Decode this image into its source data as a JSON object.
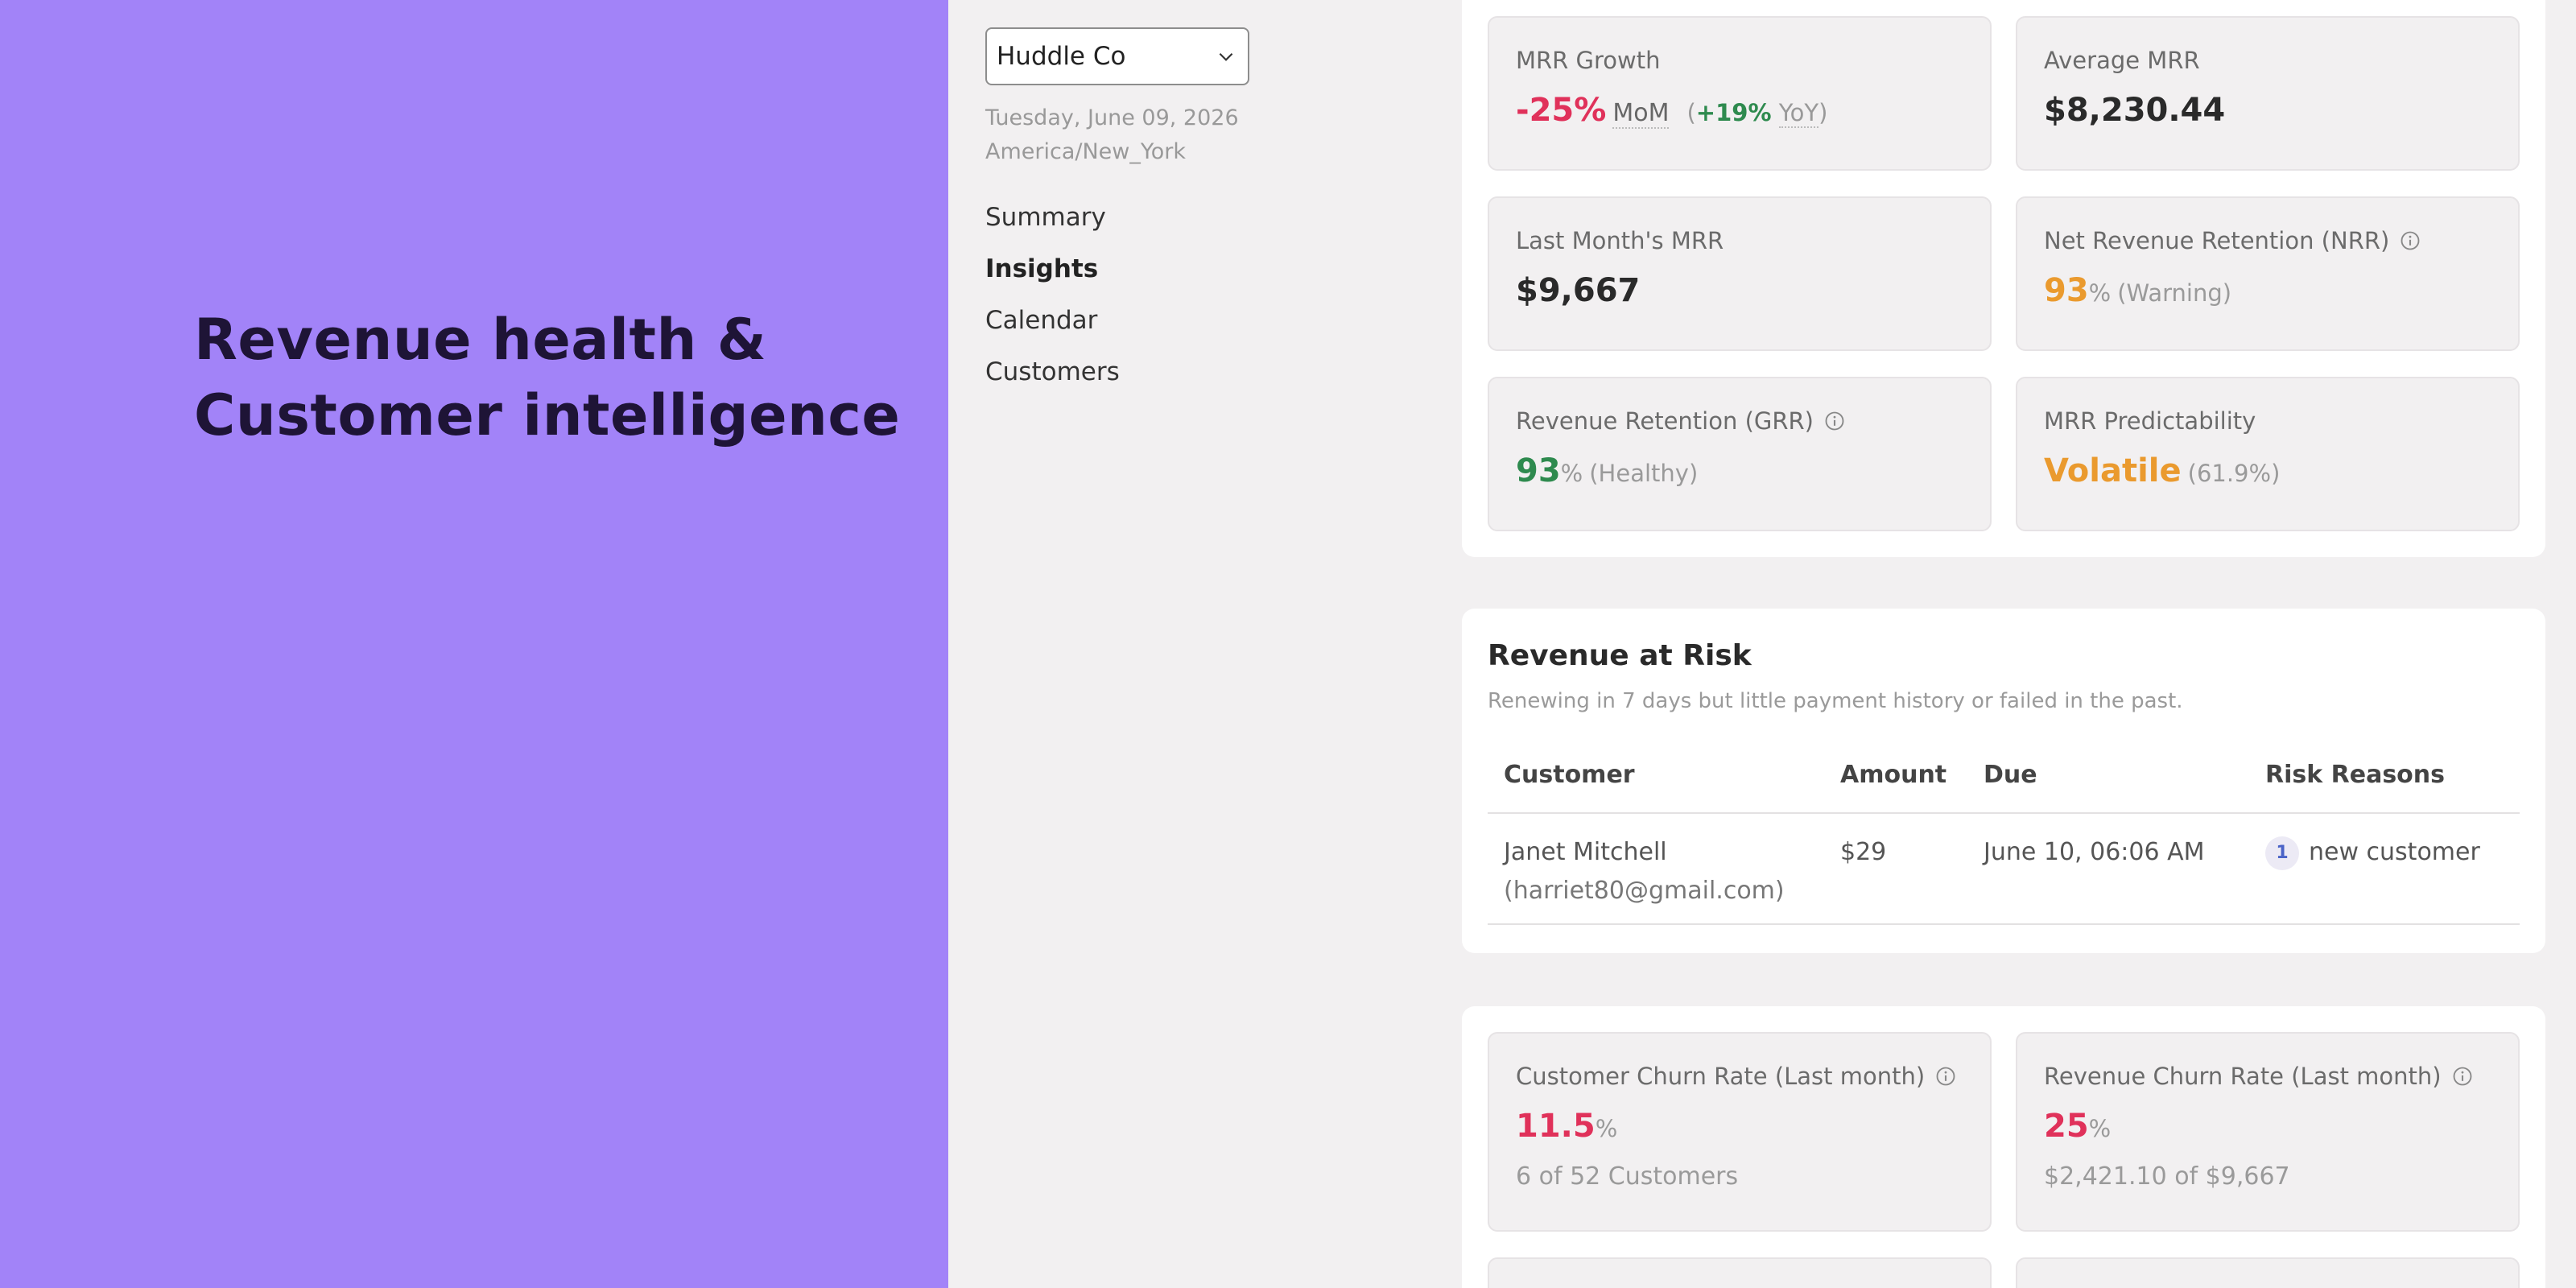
{
  "hero": {
    "title_line1": "Revenue health &",
    "title_line2": "Customer intelligence"
  },
  "sidebar": {
    "workspace": "Huddle Co",
    "date": "Tuesday, June 09, 2026",
    "timezone": "America/New_York",
    "nav": [
      {
        "label": "Summary",
        "active": false
      },
      {
        "label": "Insights",
        "active": true
      },
      {
        "label": "Calendar",
        "active": false
      },
      {
        "label": "Customers",
        "active": false
      }
    ]
  },
  "metrics": {
    "mrr_growth": {
      "label": "MRR Growth",
      "value": "-25%",
      "period": "MoM",
      "yoy_open": "(",
      "yoy_value": "+19%",
      "yoy_label": "YoY",
      "yoy_close": ")"
    },
    "average_mrr": {
      "label": "Average MRR",
      "value": "$8,230.44"
    },
    "last_month_mrr": {
      "label": "Last Month's MRR",
      "value": "$9,667"
    },
    "nrr": {
      "label": "Net Revenue Retention (NRR)",
      "value": "93",
      "unit": "%",
      "status": "(Warning)"
    },
    "grr": {
      "label": "Revenue Retention (GRR)",
      "value": "93",
      "unit": "%",
      "status": "(Healthy)"
    },
    "predictability": {
      "label": "MRR Predictability",
      "value": "Volatile",
      "detail": "(61.9%)"
    }
  },
  "risk": {
    "title": "Revenue at Risk",
    "description": "Renewing in 7 days but little payment history or failed in the past.",
    "columns": [
      "Customer",
      "Amount",
      "Due",
      "Risk Reasons"
    ],
    "rows": [
      {
        "name": "Janet Mitchell",
        "email": "(harriet80@gmail.com)",
        "amount": "$29",
        "due": "June 10, 06:06 AM",
        "reason_count": "1",
        "reason": "new customer"
      }
    ]
  },
  "churn": {
    "customer": {
      "label": "Customer Churn Rate (Last month)",
      "value": "11.5",
      "unit": "%",
      "sub": "6 of 52 Customers"
    },
    "revenue": {
      "label": "Revenue Churn Rate (Last month)",
      "value": "25",
      "unit": "%",
      "sub": "$2,421.10 of $9,667"
    }
  },
  "colors": {
    "hero_bg": "#a283f8",
    "negative": "#e0315a",
    "positive": "#2e8a4e",
    "warning": "#ea9a2e",
    "app_bg": "#f2f0f1"
  }
}
